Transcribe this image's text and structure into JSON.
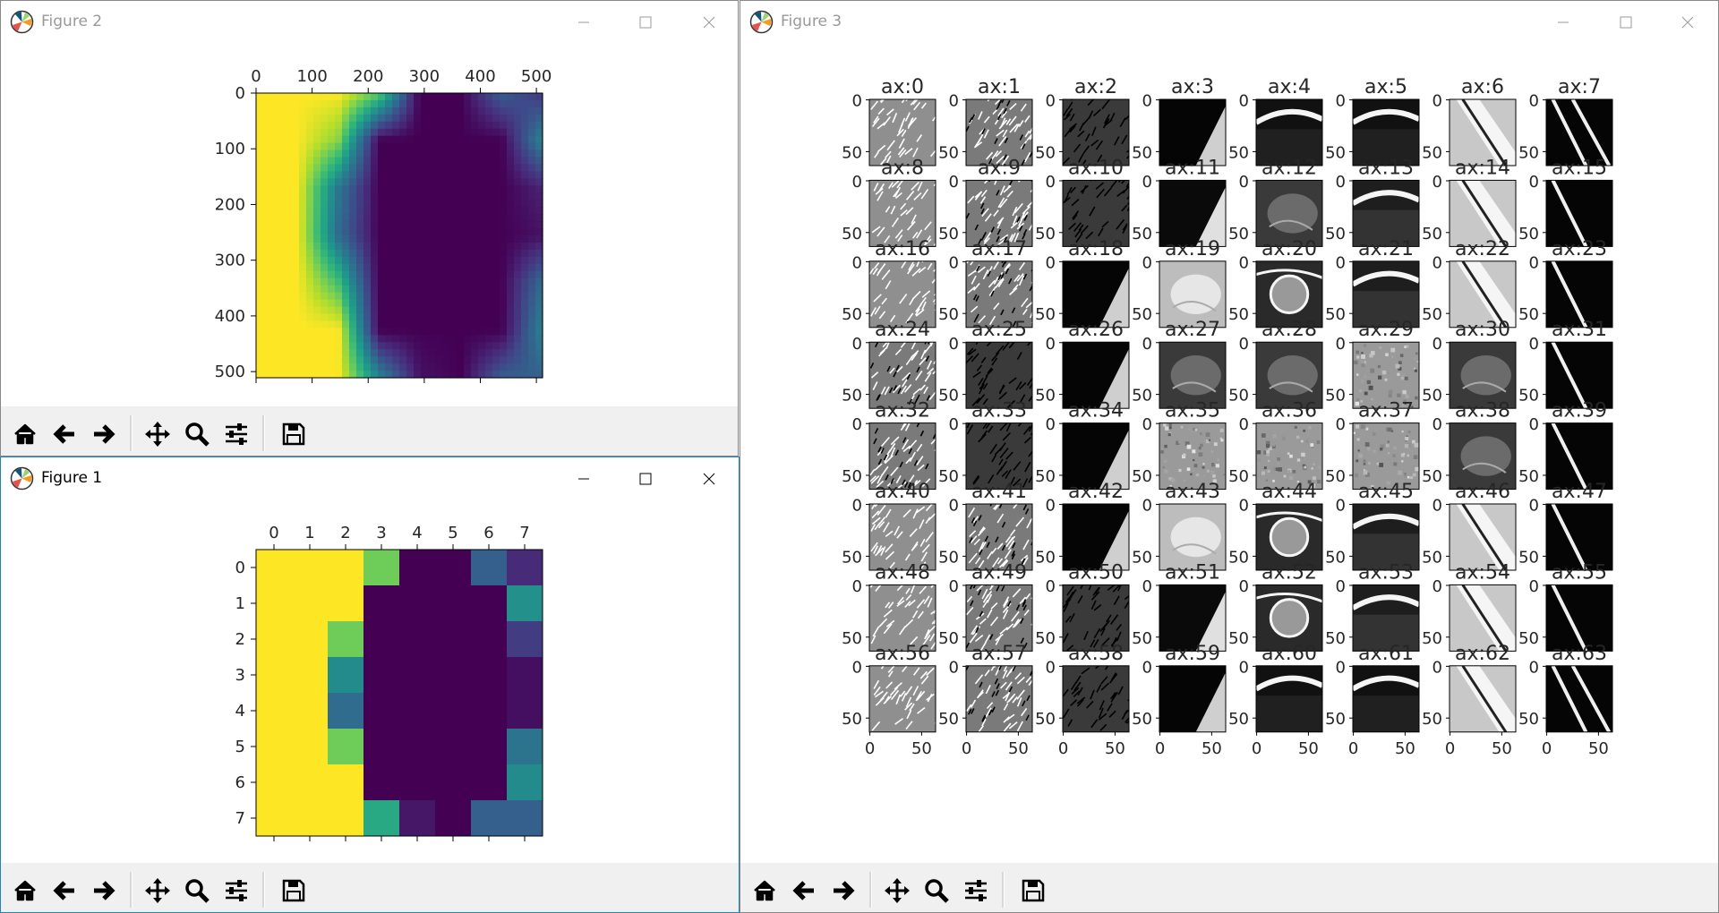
{
  "windows": {
    "fig2": {
      "title": "Figure 2"
    },
    "fig1": {
      "title": "Figure 1"
    },
    "fig3": {
      "title": "Figure 3"
    }
  },
  "toolbar_tools": [
    {
      "name": "home-icon",
      "label": "Home"
    },
    {
      "name": "back-arrow-icon",
      "label": "Back"
    },
    {
      "name": "forward-arrow-icon",
      "label": "Forward"
    },
    {
      "name": "pan-move-icon",
      "label": "Pan"
    },
    {
      "name": "zoom-magnifier-icon",
      "label": "Zoom"
    },
    {
      "name": "configure-sliders-icon",
      "label": "Configure subplots"
    },
    {
      "name": "save-floppy-icon",
      "label": "Save"
    }
  ],
  "colors": {
    "viridis_dark": "#440154",
    "viridis_yellow": "#fde725",
    "accent_border": "#1883d7"
  },
  "chart_data": [
    {
      "type": "heatmap",
      "id": "figure2-heatmap",
      "xticks": [
        0,
        100,
        200,
        300,
        400,
        500
      ],
      "yticks": [
        0,
        100,
        200,
        300,
        400,
        500
      ],
      "xlim": [
        0,
        511
      ],
      "ylim": [
        511,
        0
      ],
      "colormap": "viridis",
      "interpolation": "bilinear",
      "grid_values": [
        [
          1.0,
          1.0,
          1.0,
          0.75,
          0.0,
          0.0,
          0.3,
          0.15
        ],
        [
          1.0,
          1.0,
          0.82,
          0.0,
          0.0,
          0.0,
          0.0,
          0.45
        ],
        [
          1.0,
          1.0,
          0.4,
          0.0,
          0.0,
          0.0,
          0.0,
          0.1
        ],
        [
          1.0,
          1.0,
          0.35,
          0.0,
          0.0,
          0.0,
          0.0,
          0.05
        ],
        [
          1.0,
          1.0,
          0.7,
          0.0,
          0.0,
          0.0,
          0.0,
          0.35
        ],
        [
          1.0,
          1.0,
          1.0,
          0.0,
          0.0,
          0.0,
          0.0,
          0.45
        ],
        [
          1.0,
          1.0,
          1.0,
          0.45,
          0.05,
          0.0,
          0.3,
          0.3
        ]
      ]
    },
    {
      "type": "heatmap",
      "id": "figure1-heatmap",
      "xticks": [
        0,
        1,
        2,
        3,
        4,
        5,
        6,
        7
      ],
      "yticks": [
        0,
        1,
        2,
        3,
        4,
        5,
        6,
        7
      ],
      "colormap": "viridis",
      "values": [
        [
          1.0,
          1.0,
          1.0,
          0.78,
          0.0,
          0.0,
          0.3,
          0.12
        ],
        [
          1.0,
          1.0,
          1.0,
          0.0,
          0.0,
          0.0,
          0.0,
          0.5
        ],
        [
          1.0,
          1.0,
          0.78,
          0.0,
          0.0,
          0.0,
          0.0,
          0.18
        ],
        [
          1.0,
          1.0,
          0.48,
          0.0,
          0.0,
          0.0,
          0.0,
          0.04
        ],
        [
          1.0,
          1.0,
          0.35,
          0.0,
          0.0,
          0.0,
          0.0,
          0.04
        ],
        [
          1.0,
          1.0,
          0.78,
          0.0,
          0.0,
          0.0,
          0.0,
          0.38
        ],
        [
          1.0,
          1.0,
          1.0,
          0.0,
          0.0,
          0.0,
          0.0,
          0.48
        ],
        [
          1.0,
          1.0,
          1.0,
          0.6,
          0.06,
          0.0,
          0.3,
          0.3
        ]
      ]
    },
    {
      "type": "heatmap",
      "id": "figure3-grid",
      "rows": 8,
      "cols": 8,
      "panel_titles": [
        "ax:0",
        "ax:1",
        "ax:2",
        "ax:3",
        "ax:4",
        "ax:5",
        "ax:6",
        "ax:7",
        "ax:8",
        "ax:9",
        "ax:10",
        "ax:11",
        "ax:12",
        "ax:13",
        "ax:14",
        "ax:15",
        "ax:16",
        "ax:17",
        "ax:18",
        "ax:19",
        "ax:20",
        "ax:21",
        "ax:22",
        "ax:23",
        "ax:24",
        "ax:25",
        "ax:26",
        "ax:27",
        "ax:28",
        "ax:29",
        "ax:30",
        "ax:31",
        "ax:32",
        "ax:33",
        "ax:34",
        "ax:35",
        "ax:36",
        "ax:37",
        "ax:38",
        "ax:39",
        "ax:40",
        "ax:41",
        "ax:42",
        "ax:43",
        "ax:44",
        "ax:45",
        "ax:46",
        "ax:47",
        "ax:48",
        "ax:49",
        "ax:50",
        "ax:51",
        "ax:52",
        "ax:53",
        "ax:54",
        "ax:55",
        "ax:56",
        "ax:57",
        "ax:58",
        "ax:59",
        "ax:60",
        "ax:61",
        "ax:62",
        "ax:63"
      ],
      "xticks": [
        0,
        50
      ],
      "yticks": [
        0,
        50
      ],
      "colormap": "gray",
      "panel_styles": [
        "noise-light",
        "noise-mid",
        "noise-dark",
        "edge",
        "bone-arc",
        "bone-arc",
        "diag-band",
        "diag-double",
        "noise-light",
        "noise-mid",
        "noise-dark",
        "edge-light",
        "organ",
        "arc",
        "diag-band",
        "diag-line",
        "noise-light",
        "noise-mid",
        "edge",
        "organ-light",
        "joint",
        "arc",
        "diag-band",
        "diag-line",
        "noise-mid",
        "noise-dark",
        "edge",
        "organ",
        "organ",
        "texture",
        "organ",
        "diag-line",
        "noise-mid",
        "noise-dark",
        "edge",
        "texture",
        "texture",
        "texture",
        "organ",
        "diag-line",
        "noise-light",
        "noise-mid",
        "edge",
        "organ-light",
        "joint",
        "arc",
        "diag-band",
        "diag-line",
        "noise-light",
        "noise-mid",
        "noise-dark",
        "edge-light",
        "joint",
        "arc",
        "diag-band",
        "diag-line",
        "noise-light",
        "noise-mid",
        "noise-dark",
        "edge",
        "bone-arc",
        "bone-arc",
        "diag-band",
        "diag-double"
      ]
    }
  ]
}
